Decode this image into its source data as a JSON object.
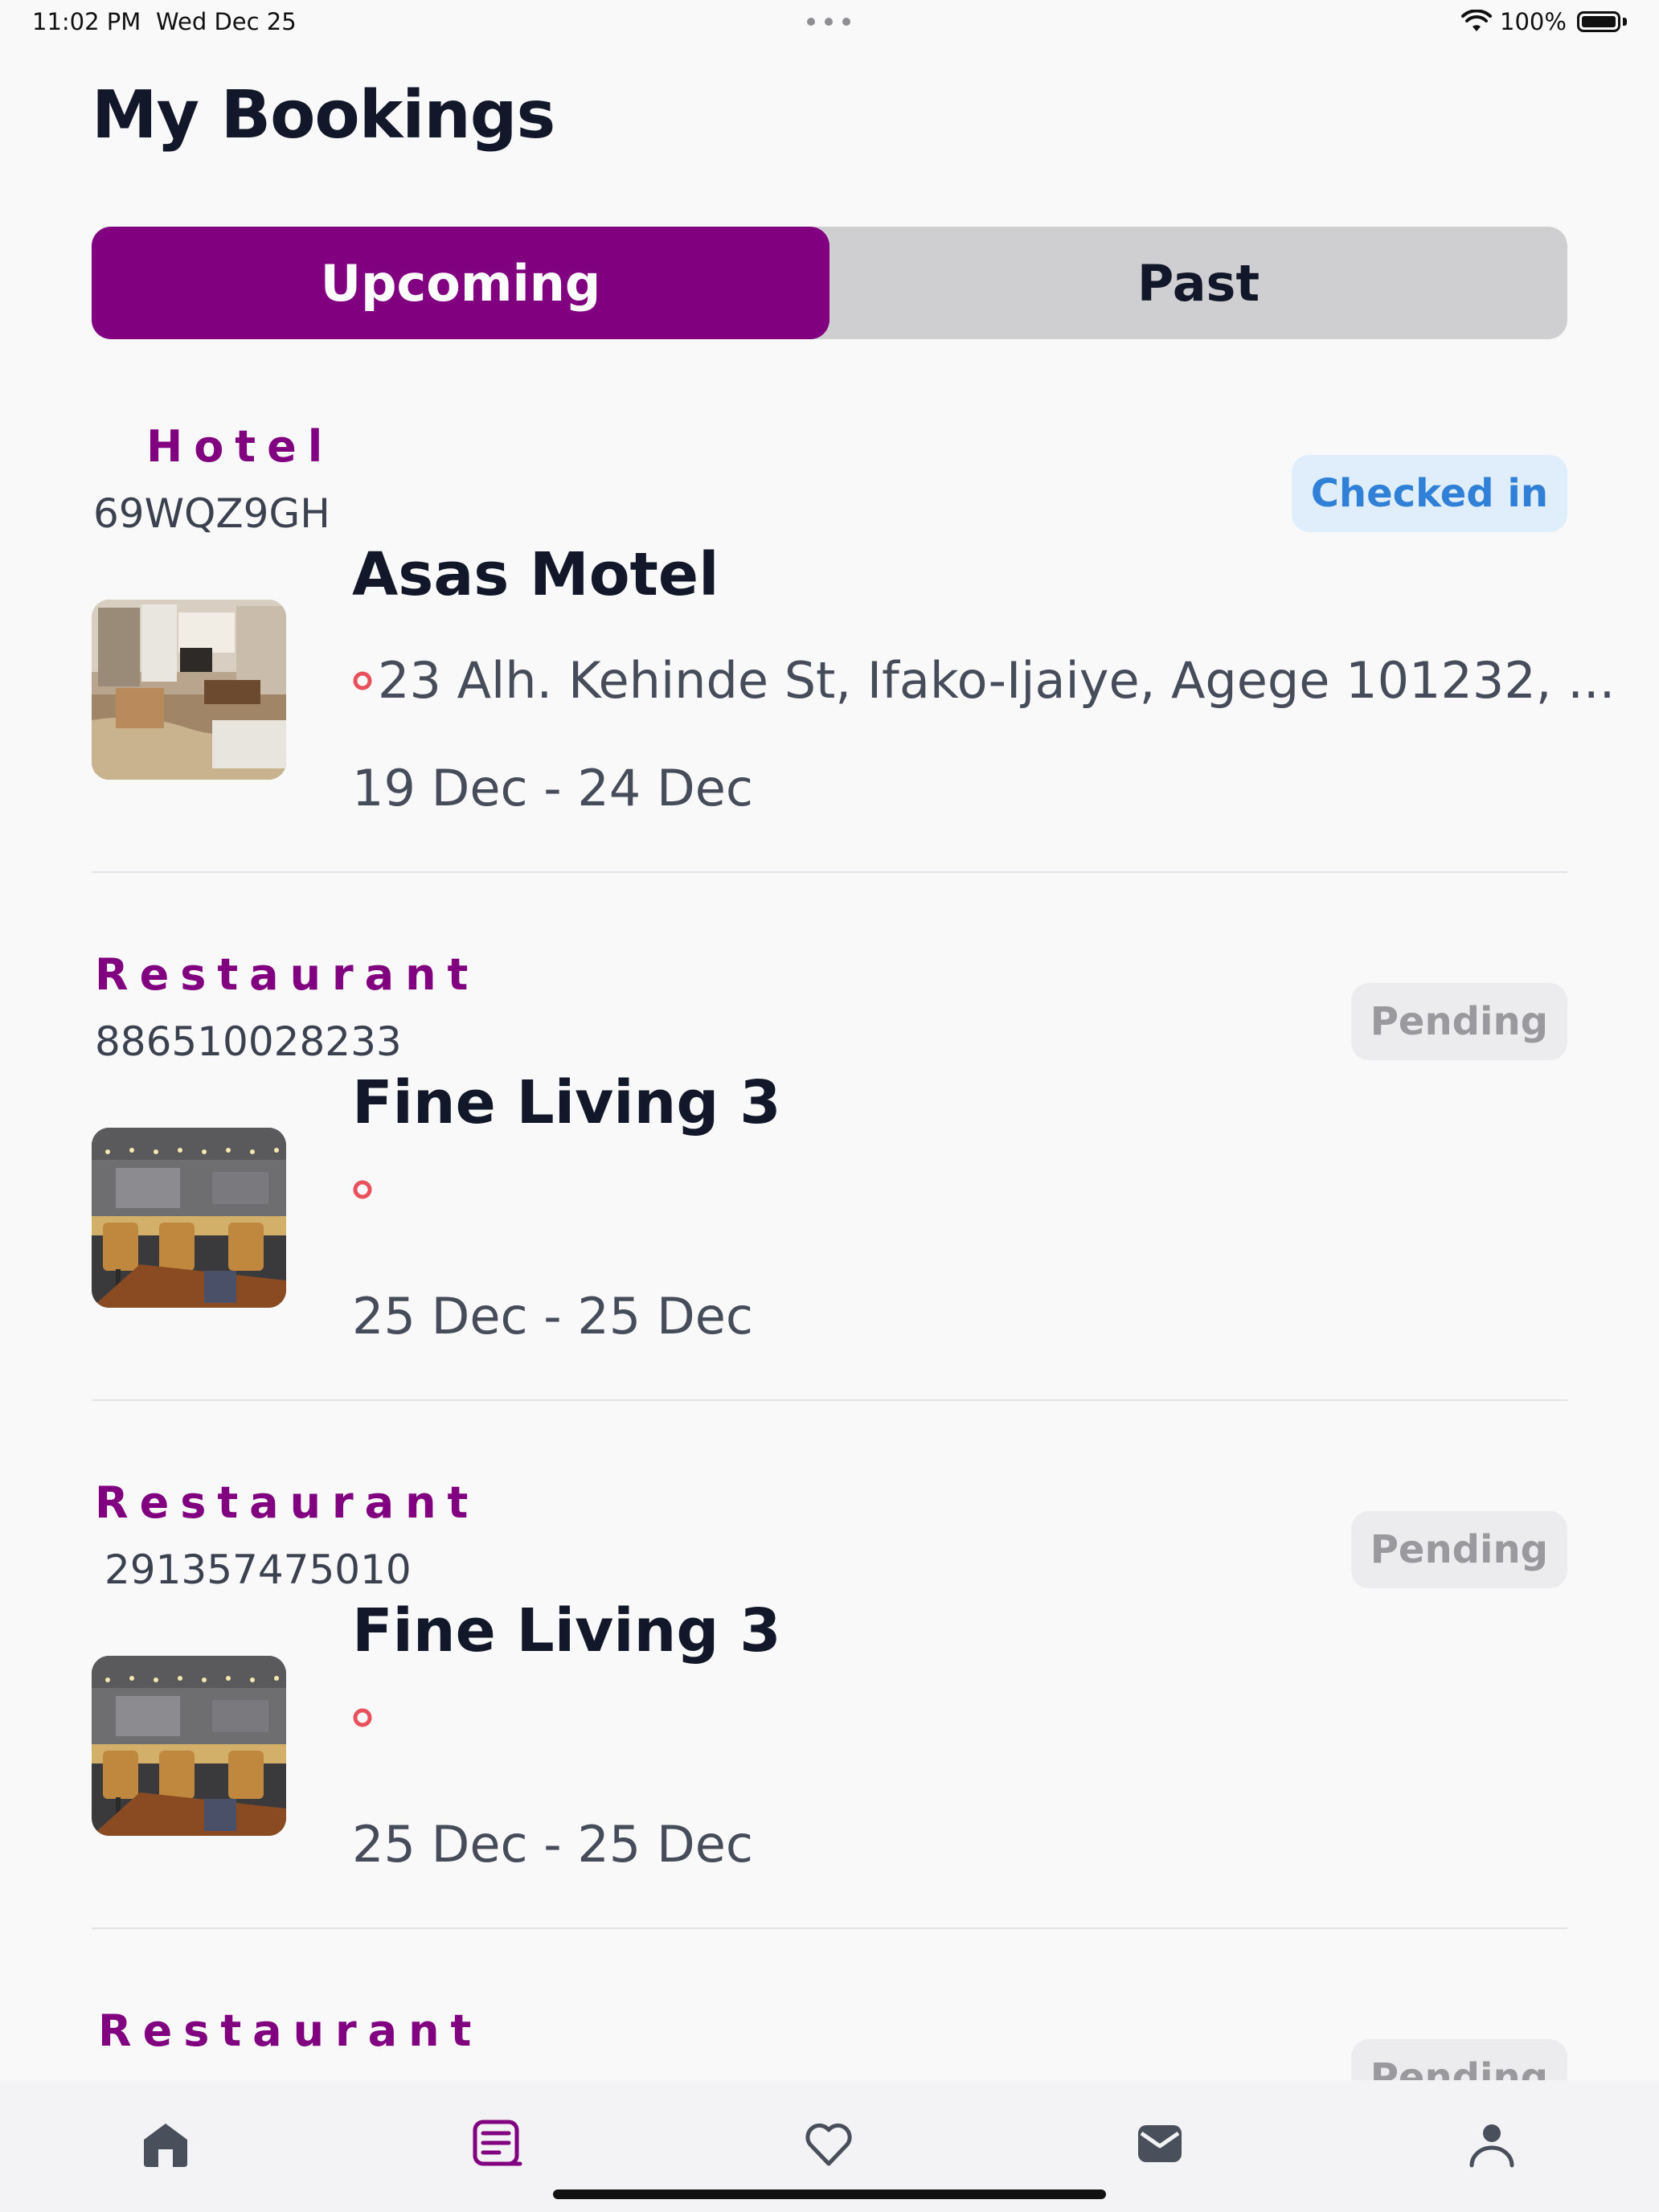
{
  "status_bar": {
    "time": "11:02 PM",
    "date": "Wed Dec 25",
    "battery": "100%"
  },
  "title": "My Bookings",
  "tabs": {
    "upcoming": "Upcoming",
    "past": "Past",
    "selected": "Upcoming"
  },
  "bookings": [
    {
      "category": "Hotel",
      "code": "69WQZ9GH",
      "status": "Checked in",
      "name": "Asas Motel",
      "address": "23 Alh. Kehinde St, Ifako-Ijaiye, Agege 101232, ...",
      "dates": "19 Dec - 24 Dec",
      "thumbnail": "hotel-room-photo"
    },
    {
      "category": "Restaurant",
      "code": "886510028233",
      "status": "Pending",
      "name": "Fine Living 3",
      "address": "",
      "dates": "25 Dec - 25 Dec",
      "thumbnail": "restaurant-bar-photo"
    },
    {
      "category": "Restaurant",
      "code": "291357475010",
      "status": "Pending",
      "name": "Fine Living 3",
      "address": "",
      "dates": "25 Dec - 25 Dec",
      "thumbnail": "restaurant-bar-photo"
    },
    {
      "category": "Restaurant",
      "status": "Pending"
    }
  ],
  "tab_bar": {
    "items": [
      "home-icon",
      "bookings-icon",
      "heart-icon",
      "inbox-icon",
      "profile-icon"
    ],
    "active": "bookings-icon"
  },
  "colors": {
    "accent": "#800080",
    "checked_in_text": "#2f80d6",
    "checked_in_bg": "#e0eefc",
    "pending_text": "#9a9a9e",
    "pin": "#e8505b"
  }
}
